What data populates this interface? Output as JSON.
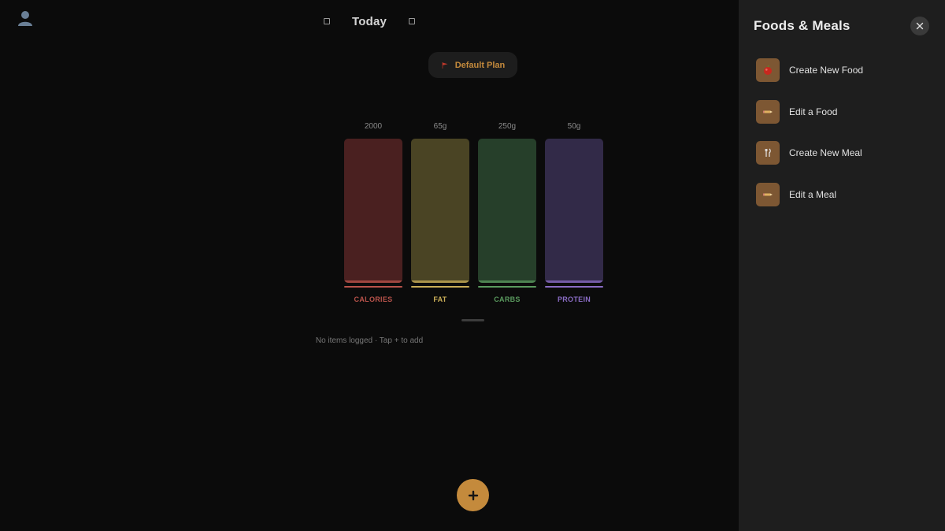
{
  "header": {
    "date_title": "Today",
    "plan_label": "Default Plan"
  },
  "macros": [
    {
      "key": "calories",
      "label": "CALORIES",
      "goal": "2000",
      "progress": 0,
      "track_color": "#4a2020",
      "accent_color": "#b9534b"
    },
    {
      "key": "fat",
      "label": "FAT",
      "goal": "65g",
      "progress": 0,
      "track_color": "#4a4424",
      "accent_color": "#c9ad57"
    },
    {
      "key": "carbs",
      "label": "CARBS",
      "goal": "250g",
      "progress": 0,
      "track_color": "#263f2a",
      "accent_color": "#5a9a5e"
    },
    {
      "key": "protein",
      "label": "PROTEIN",
      "goal": "50g",
      "progress": 0,
      "track_color": "#322a48",
      "accent_color": "#8a6cc4"
    }
  ],
  "log": {
    "empty_message": "No items logged · Tap + to add"
  },
  "side_panel": {
    "title": "Foods & Meals",
    "items": [
      {
        "label": "Create New Food",
        "icon": "apple-icon"
      },
      {
        "label": "Edit a Food",
        "icon": "pencil-icon"
      },
      {
        "label": "Create New Meal",
        "icon": "utensils-icon"
      },
      {
        "label": "Edit a Meal",
        "icon": "pencil-icon"
      }
    ]
  },
  "colors": {
    "accent": "#c48a3c",
    "background": "#0b0b0b",
    "panel": "#1e1e1e"
  }
}
